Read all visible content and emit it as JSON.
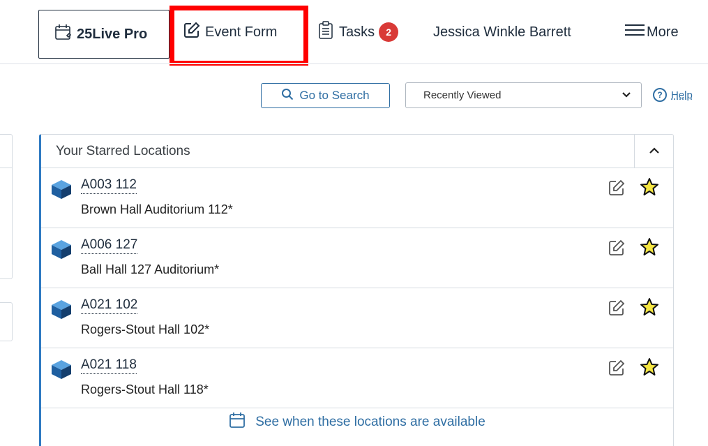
{
  "nav": {
    "brand": "25Live Pro",
    "event_form": "Event Form",
    "tasks": "Tasks",
    "tasks_count": "2",
    "user": "Jessica Winkle Barrett",
    "more": "More"
  },
  "toolbar": {
    "go_to_search": "Go to Search",
    "recently_viewed": "Recently Viewed",
    "help": "Help"
  },
  "panel": {
    "title": "Your Starred Locations",
    "items": [
      {
        "code": "A003 112",
        "name": "Brown Hall Auditorium 112*"
      },
      {
        "code": "A006 127",
        "name": "Ball Hall 127 Auditorium*"
      },
      {
        "code": "A021 102",
        "name": "Rogers-Stout Hall 102*"
      },
      {
        "code": "A021 118",
        "name": "Rogers-Stout Hall 118*"
      }
    ],
    "footer_link": "See when these locations are available"
  },
  "colors": {
    "accent": "#2f6ea3",
    "highlight": "#ff0000",
    "badge": "#d93a37",
    "star": "#f5e642",
    "cube": "#2f7ac2"
  }
}
